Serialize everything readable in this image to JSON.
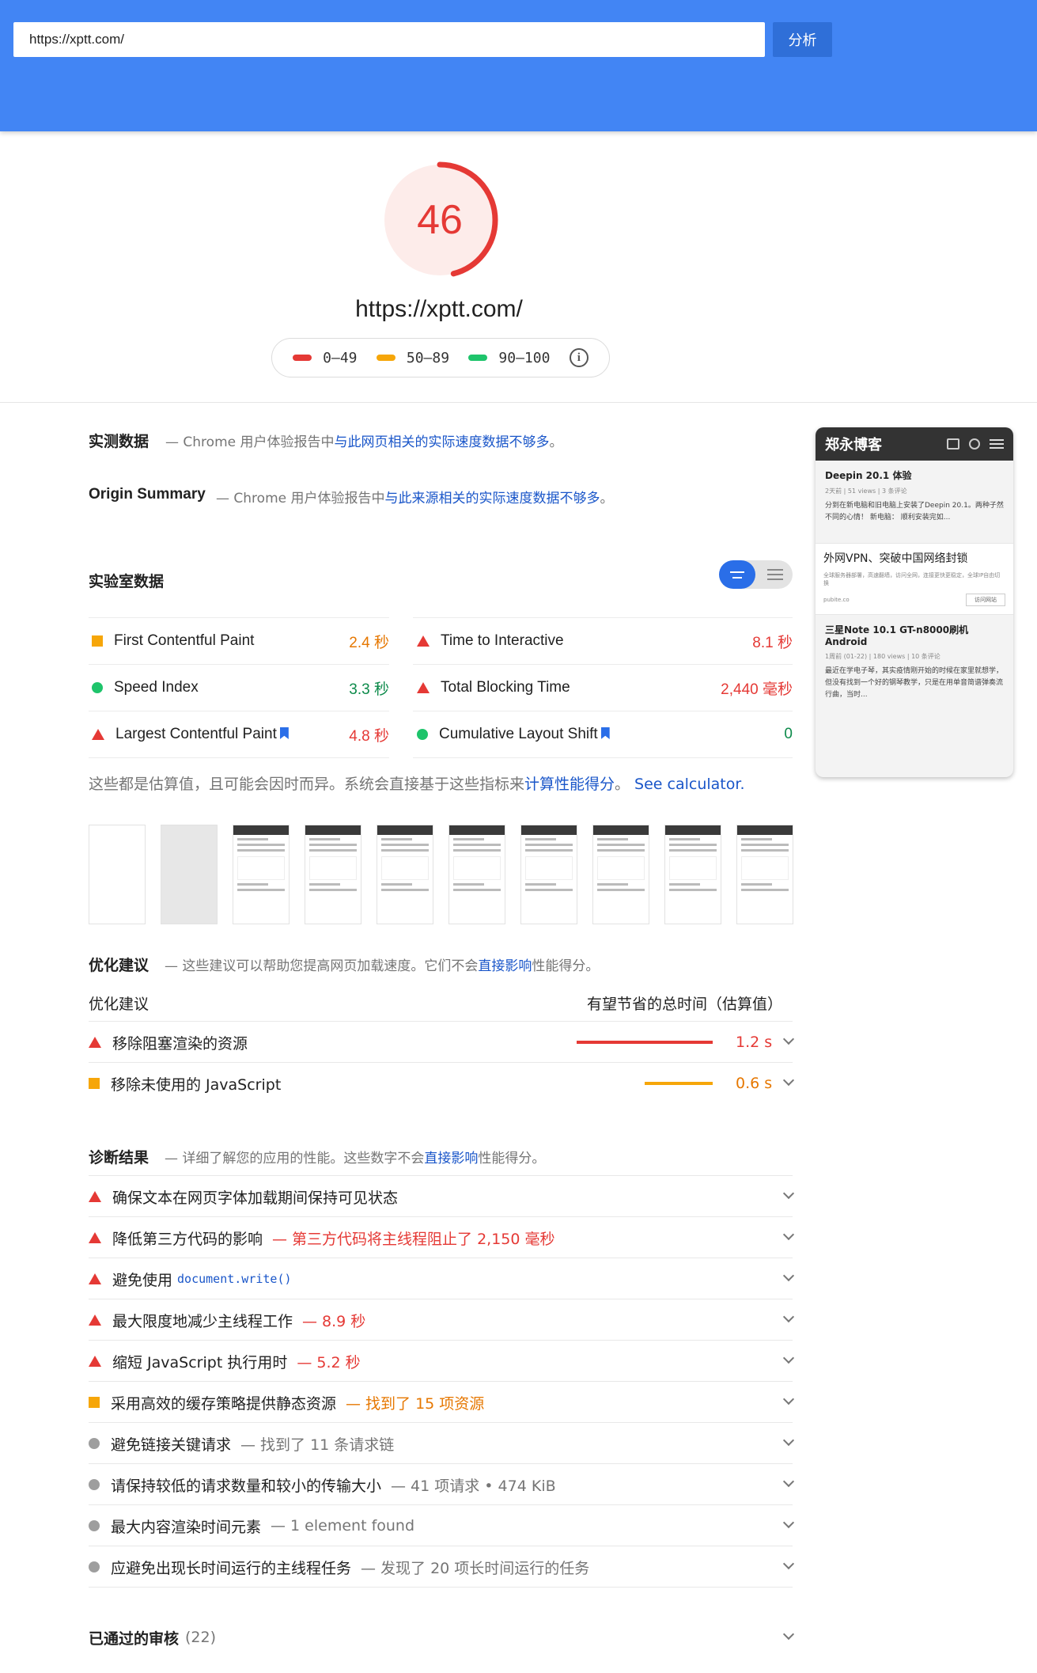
{
  "header": {
    "url_value": "https://xptt.com/",
    "analyze_label": "分析"
  },
  "score": {
    "value": "46",
    "url": "https://xptt.com/",
    "color": "#e53935",
    "fraction": 0.46
  },
  "legend": {
    "bad": "0–49",
    "average": "50–89",
    "good": "90–100",
    "colors": {
      "bad": "#e53935",
      "average": "#f6a609",
      "good": "#1ec46b"
    }
  },
  "field_data": {
    "title": "实测数据",
    "desc_prefix": "— Chrome 用户体验报告中",
    "desc_link": "与此网页相关的实际速度数据不够多",
    "desc_suffix": "。"
  },
  "origin_summary": {
    "title": "Origin Summary",
    "desc_prefix": "— Chrome 用户体验报告中",
    "desc_link": "与此来源相关的实际速度数据不够多",
    "desc_suffix": "。"
  },
  "lab_data": {
    "title": "实验室数据",
    "metrics": [
      {
        "label": "First Contentful Paint",
        "value": "2.4 秒",
        "status": "average",
        "bookmark": false
      },
      {
        "label": "Time to Interactive",
        "value": "8.1 秒",
        "status": "bad",
        "bookmark": false
      },
      {
        "label": "Speed Index",
        "value": "3.3 秒",
        "status": "good",
        "bookmark": false
      },
      {
        "label": "Total Blocking Time",
        "value": "2,440 毫秒",
        "status": "bad",
        "bookmark": false
      },
      {
        "label": "Largest Contentful Paint",
        "value": "4.8 秒",
        "status": "bad",
        "bookmark": true
      },
      {
        "label": "Cumulative Layout Shift",
        "value": "0",
        "status": "good",
        "bookmark": true
      }
    ],
    "note_prefix": "这些都是估算值，且可能会因时而异。系统会直接基于这些指标来",
    "note_link1": "计算性能得分",
    "note_mid": "。",
    "note_link2": "See calculator."
  },
  "opportunities": {
    "title": "优化建议",
    "desc_prefix": "— 这些建议可以帮助您提高网页加载速度。它们不会",
    "desc_link": "直接影响",
    "desc_suffix": "性能得分。",
    "col_left": "优化建议",
    "col_right": "有望节省的总时间（估算值）",
    "items": [
      {
        "label": "移除阻塞渲染的资源",
        "value": "1.2 s",
        "status": "bad",
        "savings_fraction": 1.0
      },
      {
        "label": "移除未使用的 JavaScript",
        "value": "0.6 s",
        "status": "average",
        "savings_fraction": 0.5
      }
    ]
  },
  "diagnostics": {
    "title": "诊断结果",
    "desc_prefix": "— 详细了解您的应用的性能。这些数字不会",
    "desc_link": "直接影响",
    "desc_suffix": "性能得分。",
    "items": [
      {
        "label": "确保文本在网页字体加载期间保持可见状态",
        "extra": "",
        "status": "bad"
      },
      {
        "label": "降低第三方代码的影响",
        "extra": "— 第三方代码将主线程阻止了 2,150 毫秒",
        "status": "bad"
      },
      {
        "label": "避免使用",
        "code": "document.write()",
        "extra": "",
        "status": "bad"
      },
      {
        "label": "最大限度地减少主线程工作",
        "extra": "— 8.9 秒",
        "status": "bad"
      },
      {
        "label": "缩短 JavaScript 执行用时",
        "extra": "— 5.2 秒",
        "status": "bad"
      },
      {
        "label": "采用高效的缓存策略提供静态资源",
        "extra": "— 找到了 15 项资源",
        "status": "average"
      },
      {
        "label": "避免链接关键请求",
        "extra": "— 找到了 11 条请求链",
        "status": "info"
      },
      {
        "label": "请保持较低的请求数量和较小的传输大小",
        "extra": "— 41 项请求 • 474 KiB",
        "status": "info"
      },
      {
        "label": "最大内容渲染时间元素",
        "extra": "— 1 element found",
        "status": "info"
      },
      {
        "label": "应避免出现长时间运行的主线程任务",
        "extra": "— 发现了 20 项长时间运行的任务",
        "status": "info"
      }
    ]
  },
  "passed": {
    "title": "已通过的审核",
    "count": "(22)"
  },
  "screenshot": {
    "site_name": "郑永博客",
    "post1_title": "Deepin 20.1 体验",
    "post1_meta": "2天前 | 51 views | 3 条评论",
    "post1_text": "分到在新电脑和旧电脑上安装了Deepin 20.1。两种子然不同的心情！ 新电脑： 顺利安装完如...",
    "ad_title": "外网VPN、突破中国网络封锁",
    "ad_small": "全球服务器部署，高速翻墙，访问全网，连接更快更稳定，全球IP自由切换",
    "ad_tag": "pubite.co",
    "ad_button": "访问网站",
    "post2_title": "三星Note 10.1 GT-n8000刷机Android",
    "post2_meta": "1周前 (01-22) | 180 views | 10 条评论",
    "post2_text": "最近在学电子琴，其实疫情刚开始的时候在家里就想学，但没有找到一个好的钢琴教学，只是在用单音简谱弹奏流行曲，当时..."
  }
}
